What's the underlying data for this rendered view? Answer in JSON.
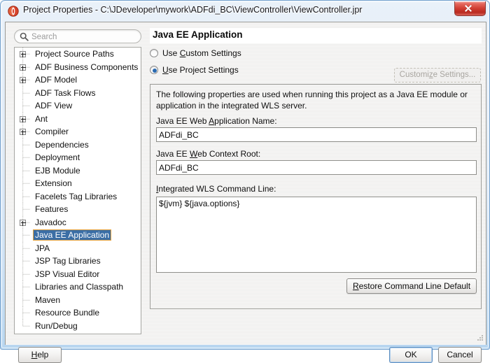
{
  "window": {
    "title": "Project Properties - C:\\JDeveloper\\mywork\\ADFdi_BC\\ViewController\\ViewController.jpr",
    "app_icon": "jdeveloper-logo-icon",
    "close_icon": "close-icon",
    "resize_grip_icon": "resize-grip-icon",
    "frame_accent": "#b8d6f0",
    "close_accent": "#cf3c30"
  },
  "search": {
    "placeholder": "Search",
    "value": "",
    "icon": "search-icon"
  },
  "tree": {
    "selected": "Java EE Application",
    "selection_bg": "#3b6ea5",
    "selection_border": "#e8a33d",
    "items": [
      {
        "label": "Project Source Paths",
        "expandable": true
      },
      {
        "label": "ADF Business Components",
        "expandable": true
      },
      {
        "label": "ADF Model",
        "expandable": true
      },
      {
        "label": "ADF Task Flows",
        "expandable": false
      },
      {
        "label": "ADF View",
        "expandable": false
      },
      {
        "label": "Ant",
        "expandable": true
      },
      {
        "label": "Compiler",
        "expandable": true
      },
      {
        "label": "Dependencies",
        "expandable": false
      },
      {
        "label": "Deployment",
        "expandable": false
      },
      {
        "label": "EJB Module",
        "expandable": false
      },
      {
        "label": "Extension",
        "expandable": false
      },
      {
        "label": "Facelets Tag Libraries",
        "expandable": false
      },
      {
        "label": "Features",
        "expandable": false
      },
      {
        "label": "Javadoc",
        "expandable": true
      },
      {
        "label": "Java EE Application",
        "expandable": false,
        "selected": true
      },
      {
        "label": "JPA",
        "expandable": false
      },
      {
        "label": "JSP Tag Libraries",
        "expandable": false
      },
      {
        "label": "JSP Visual Editor",
        "expandable": false
      },
      {
        "label": "Libraries and Classpath",
        "expandable": false
      },
      {
        "label": "Maven",
        "expandable": false
      },
      {
        "label": "Resource Bundle",
        "expandable": false
      }
    ],
    "last_item": {
      "label": "Run/Debug",
      "expandable": false
    }
  },
  "panel": {
    "title": "Java EE Application",
    "radios": [
      {
        "label_pre": "Use ",
        "mnemonic": "C",
        "label_post": "ustom Settings",
        "checked": false
      },
      {
        "label_pre": "",
        "mnemonic": "U",
        "label_post": "se Project Settings",
        "checked": true
      }
    ],
    "customize_button": {
      "pre": "Customi",
      "mnemonic": "z",
      "post": "e Settings...",
      "enabled": false
    },
    "description": "The following properties are used when running this project as a Java EE module or application in the integrated WLS server.",
    "fields": [
      {
        "label_pre": "Java EE Web ",
        "mnemonic": "A",
        "label_post": "pplication Name:",
        "value": "ADFdi_BC"
      },
      {
        "label_pre": "Java EE ",
        "mnemonic": "W",
        "label_post": "eb Context Root:",
        "value": "ADFdi_BC"
      }
    ],
    "command_line": {
      "label_pre": "",
      "mnemonic": "I",
      "label_post": "ntegrated WLS Command Line:",
      "value": "${jvm} ${java.options}"
    },
    "restore_button": {
      "pre": "",
      "mnemonic": "R",
      "post": "estore Command Line Default"
    }
  },
  "footer": {
    "help": {
      "pre": "",
      "mnemonic": "H",
      "post": "elp"
    },
    "ok": "OK",
    "cancel": "Cancel",
    "ok_focused": true
  }
}
